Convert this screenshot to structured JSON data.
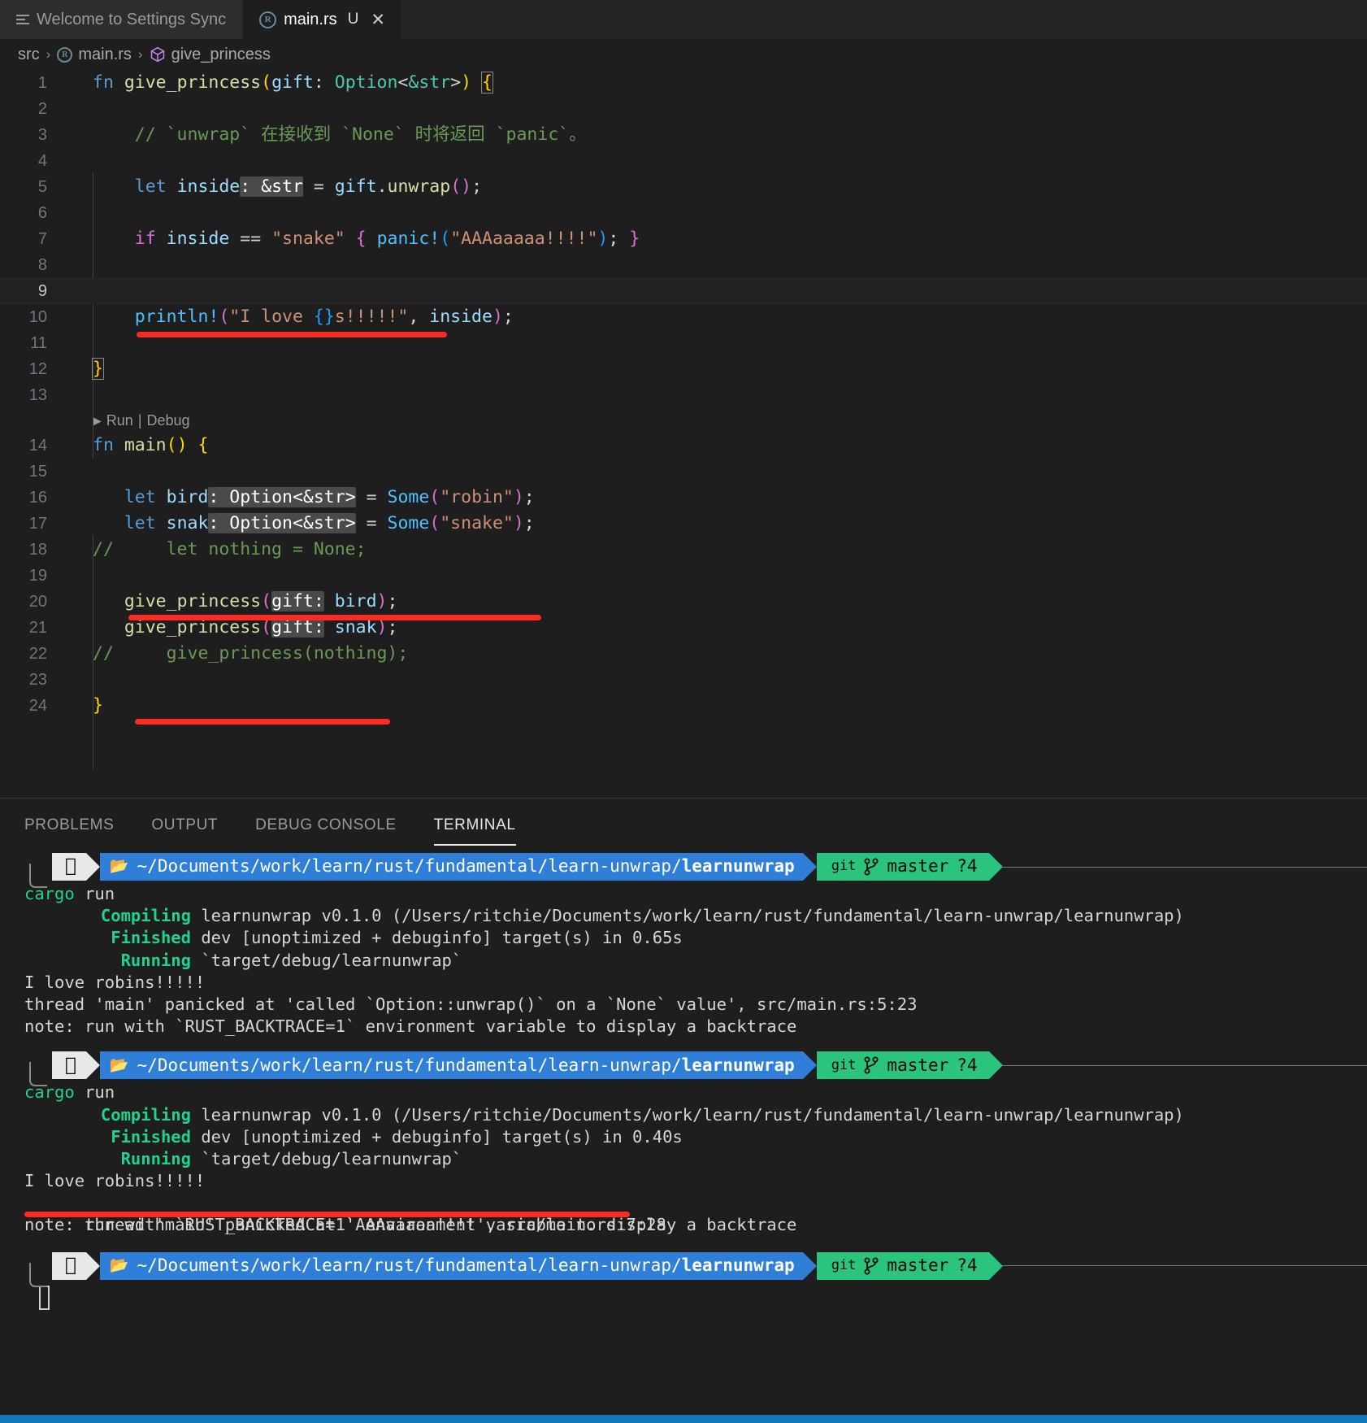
{
  "window": {
    "tabs": [
      {
        "label": "Welcome to Settings Sync",
        "icon": "hamburger-icon",
        "active": false,
        "dirty": "",
        "closeable": false
      },
      {
        "label": "main.rs",
        "icon": "rust-icon",
        "active": true,
        "dirty": "U",
        "closeable": true
      }
    ]
  },
  "breadcrumb": {
    "items": [
      "src",
      "main.rs",
      "give_princess"
    ],
    "separator": "›",
    "icons": [
      "",
      "rust-icon",
      "cube-icon"
    ]
  },
  "editor": {
    "codelens": {
      "run": "Run",
      "separator": "|",
      "debug": "Debug",
      "play_icon": "play-icon"
    },
    "current_line": 9,
    "lines": [
      {
        "n": 1,
        "text": "fn give_princess(gift: Option<&str>) {"
      },
      {
        "n": 2,
        "text": ""
      },
      {
        "n": 3,
        "text": "    // `unwrap` 在接收到 `None` 时将返回 `panic`。"
      },
      {
        "n": 4,
        "text": ""
      },
      {
        "n": 5,
        "text": "    let inside: &str = gift.unwrap();"
      },
      {
        "n": 6,
        "text": ""
      },
      {
        "n": 7,
        "text": "    if inside == \"snake\" { panic!(\"AAAaaaaa!!!!\"); }"
      },
      {
        "n": 8,
        "text": ""
      },
      {
        "n": 9,
        "text": ""
      },
      {
        "n": 10,
        "text": "    println!(\"I love {}s!!!!!\", inside);"
      },
      {
        "n": 11,
        "text": ""
      },
      {
        "n": 12,
        "text": "}"
      },
      {
        "n": 13,
        "text": ""
      },
      {
        "n": 14,
        "text": "fn main() {"
      },
      {
        "n": 15,
        "text": ""
      },
      {
        "n": 16,
        "text": "    let bird: Option<&str> = Some(\"robin\");"
      },
      {
        "n": 17,
        "text": "    let snak: Option<&str> = Some(\"snake\");"
      },
      {
        "n": 18,
        "text": "//     let nothing = None;"
      },
      {
        "n": 19,
        "text": ""
      },
      {
        "n": 20,
        "text": "    give_princess(gift: bird);"
      },
      {
        "n": 21,
        "text": "    give_princess(gift: snak);"
      },
      {
        "n": 22,
        "text": "//     give_princess(nothing);"
      },
      {
        "n": 23,
        "text": ""
      },
      {
        "n": 24,
        "text": "}"
      }
    ],
    "inlay_hints": [
      ": &str",
      ": Option<&str>",
      ": Option<&str>",
      "gift:",
      "gift:"
    ],
    "annotation_color": "#fc2b23"
  },
  "panel": {
    "tabs": [
      "PROBLEMS",
      "OUTPUT",
      "DEBUG CONSOLE",
      "TERMINAL"
    ],
    "active_tab": "TERMINAL"
  },
  "terminal": {
    "prompt": {
      "apple_icon": "apple-logo-icon",
      "folder_icon": "folder-icon",
      "path_prefix": "~/Documents/work/learn/rust/fundamental/learn-unwrap/",
      "path_last": "learnunwrap",
      "git_label": "git",
      "git_icon": "git-branch-icon",
      "branch": "master",
      "status": "?4"
    },
    "blocks": [
      {
        "command": "cargo run",
        "command_kw": "cargo",
        "command_arg": "run",
        "lines": [
          {
            "label": "Compiling",
            "rest": " learnunwrap v0.1.0 (/Users/ritchie/Documents/work/learn/rust/fundamental/learn-unwrap/learnunwrap)"
          },
          {
            "label": "Finished",
            "rest": " dev [unoptimized + debuginfo] target(s) in 0.65s"
          },
          {
            "label": "Running",
            "rest": " `target/debug/learnunwrap`"
          },
          {
            "label": "",
            "rest": "I love robins!!!!!"
          },
          {
            "label": "",
            "rest": "thread 'main' panicked at 'called `Option::unwrap()` on a `None` value', src/main.rs:5:23"
          },
          {
            "label": "",
            "rest": "note: run with `RUST_BACKTRACE=1` environment variable to display a backtrace"
          }
        ]
      },
      {
        "command": "cargo run",
        "command_kw": "cargo",
        "command_arg": "run",
        "lines": [
          {
            "label": "Compiling",
            "rest": " learnunwrap v0.1.0 (/Users/ritchie/Documents/work/learn/rust/fundamental/learn-unwrap/learnunwrap)"
          },
          {
            "label": "Finished",
            "rest": " dev [unoptimized + debuginfo] target(s) in 0.40s"
          },
          {
            "label": "Running",
            "rest": " `target/debug/learnunwrap`"
          },
          {
            "label": "",
            "rest": "I love robins!!!!!"
          },
          {
            "label": "",
            "rest": "thread 'main' panicked at 'AAAaaaaa!!!!', src/main.rs:7:28"
          },
          {
            "label": "",
            "rest": "note: run with `RUST_BACKTRACE=1` environment variable to display a backtrace"
          }
        ]
      }
    ]
  },
  "colors": {
    "editor_bg": "#1e1e1e",
    "tab_active_bg": "#1e1e1e",
    "tab_inactive_bg": "#2d2d2d",
    "annotation_red": "#fc2b23",
    "prompt_blue": "#2f7fd8",
    "prompt_green": "#2bc47d",
    "status_bar_blue": "#1177bb",
    "terminal_green": "#23d18b"
  }
}
